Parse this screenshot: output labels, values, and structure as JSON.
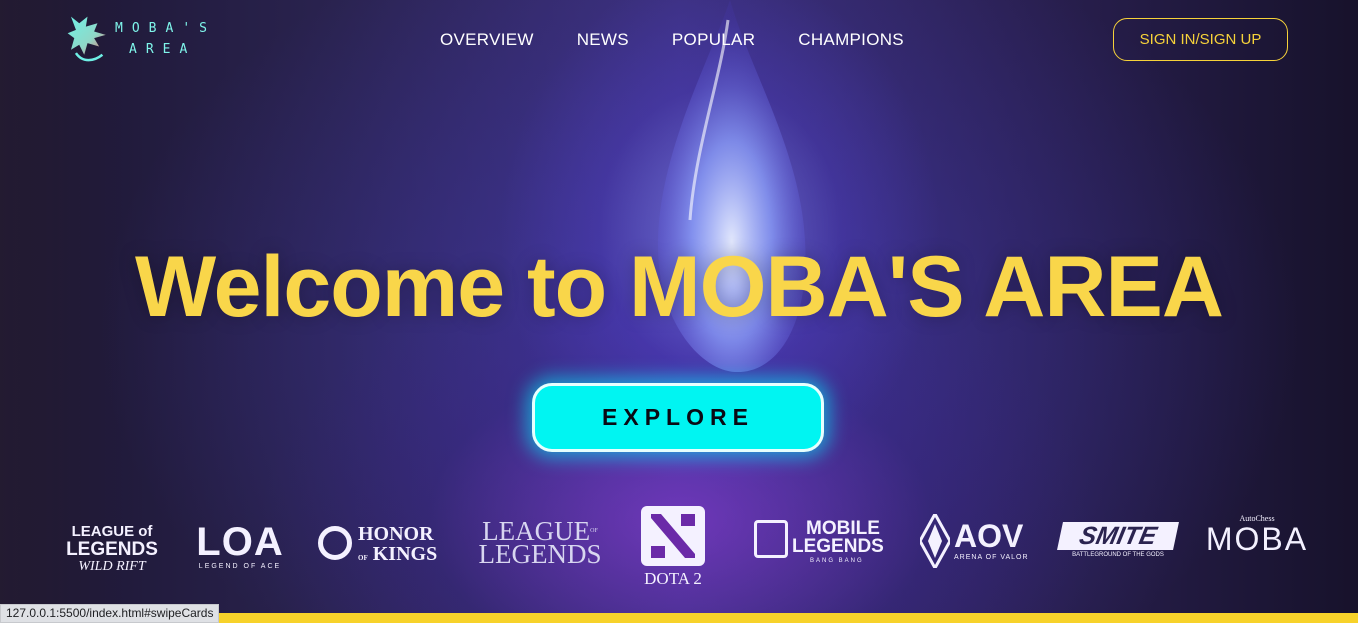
{
  "header": {
    "logo_text_line1": "MOBA'S",
    "logo_text_line2": "AREA",
    "nav": [
      "OVERVIEW",
      "NEWS",
      "POPULAR",
      "CHAMPIONS"
    ],
    "signin_label": "SIGN IN/SIGN UP"
  },
  "hero": {
    "title": "Welcome to MOBA'S AREA",
    "explore_label": "EXPLORE"
  },
  "brands": {
    "wild_rift": {
      "line1": "LEAGUE of",
      "line2": "LEGENDS",
      "sub": "WILD RIFT"
    },
    "loa": {
      "name": "LOA",
      "sub": "LEGEND OF ACE"
    },
    "honor_of_kings": {
      "line1": "HONOR",
      "line2": "KINGS",
      "of": "OF"
    },
    "league_of_legends": {
      "line1": "LEAGUE",
      "line2": "LEGENDS",
      "of": "OF"
    },
    "dota2": {
      "name": "DOTA 2"
    },
    "mobile_legends": {
      "line1": "MOBILE",
      "line2": "LEGENDS",
      "sub": "BANG BANG"
    },
    "aov": {
      "name": "AOV",
      "sub": "ARENA OF VALOR"
    },
    "smite": {
      "name": "SMITE",
      "sub": "BATTLEGROUND OF THE GODS"
    },
    "autochess_moba": {
      "top": "AutoChess",
      "name": "MOBA"
    }
  },
  "status_bar": {
    "url": "127.0.0.1:5500/index.html#swipeCards"
  },
  "colors": {
    "accent_yellow": "#f9d64a",
    "explore_cyan": "#00f5f2",
    "logo_teal": "#7ff5ea"
  }
}
